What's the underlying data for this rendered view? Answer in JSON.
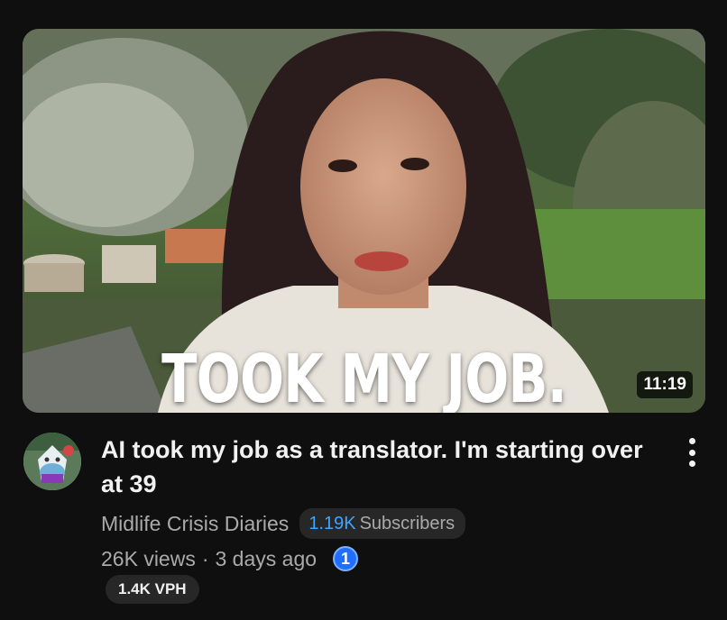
{
  "video": {
    "thumbnail_caption": "TOOK MY JOB.",
    "duration": "11:19",
    "title": "AI took my job as a translator. I'm starting over at 39"
  },
  "channel": {
    "name": "Midlife Crisis Diaries",
    "subscriber_count": "1.19K",
    "subscriber_label": "Subscribers"
  },
  "meta": {
    "views": "26K views",
    "separator": "·",
    "age": "3 days ago",
    "rank_badge": "1",
    "vph": "1.4K VPH"
  },
  "icons": {
    "more": "more-vert-icon"
  },
  "colors": {
    "background": "#0f0f0f",
    "subscriber_count": "#3ea6ff",
    "rank_badge": "#1f6fff",
    "secondary_text": "#aaaaaa"
  }
}
